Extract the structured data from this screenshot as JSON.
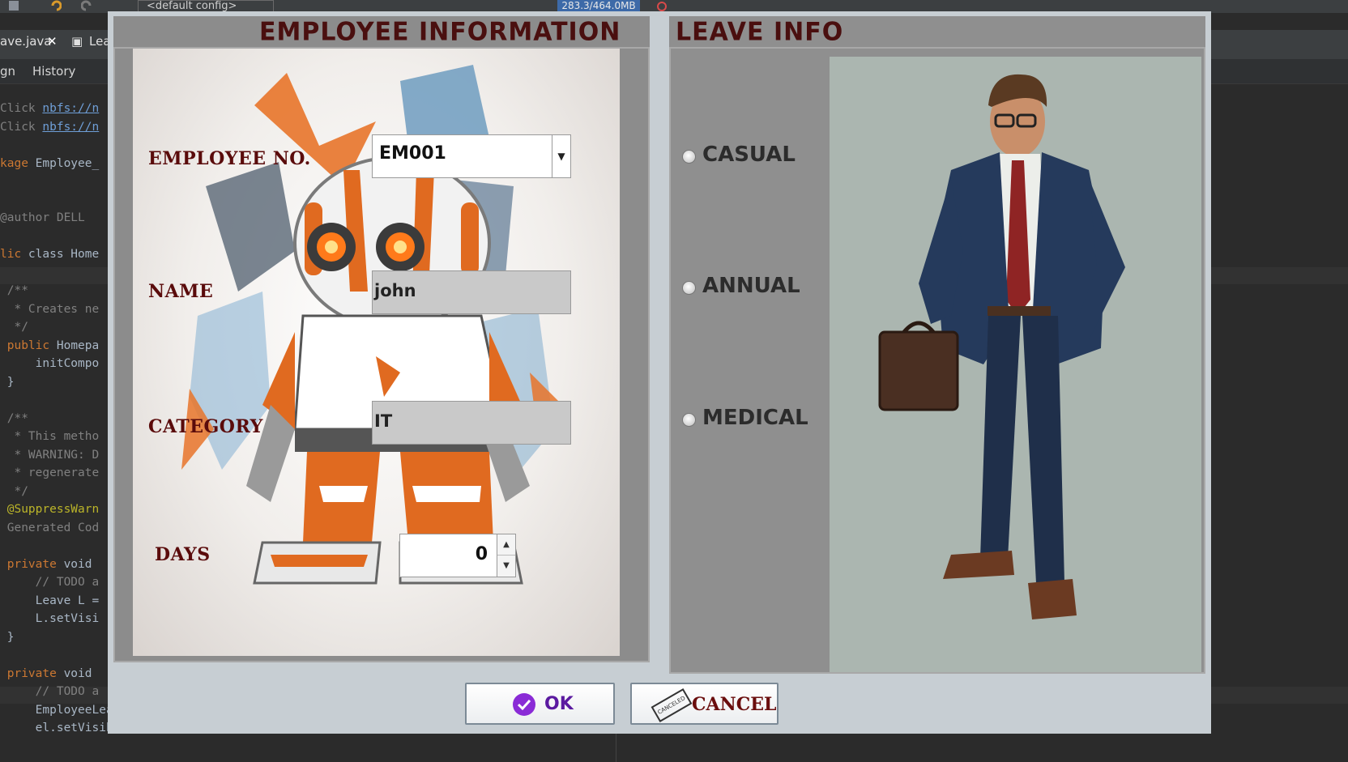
{
  "ide": {
    "config": "<default config>",
    "memory": "283.3/464.0MB",
    "tabs": [
      "ave.java",
      "Lea"
    ],
    "subtabs": [
      "gn",
      "History"
    ],
    "code_lines": [
      {
        "t": "Click nbfs://n",
        "c": "cm"
      },
      {
        "t": "Click nbfs://n",
        "c": "cm"
      },
      {
        "t": "",
        "c": ""
      },
      {
        "t": "kage Employee_",
        "c": "pl"
      },
      {
        "t": "",
        "c": ""
      },
      {
        "t": "",
        "c": ""
      },
      {
        "t": "@author DELL",
        "c": "cm"
      },
      {
        "t": "",
        "c": ""
      },
      {
        "t": "lic class Home",
        "c": "pl"
      },
      {
        "t": "",
        "c": ""
      },
      {
        "t": " /**",
        "c": "cm"
      },
      {
        "t": "  * Creates ne",
        "c": "cm"
      },
      {
        "t": "  */",
        "c": "cm"
      },
      {
        "t": " public Homepa",
        "c": "pl"
      },
      {
        "t": "     initCompo",
        "c": "pl"
      },
      {
        "t": " }",
        "c": "pl"
      },
      {
        "t": "",
        "c": ""
      },
      {
        "t": " /**",
        "c": "cm"
      },
      {
        "t": "  * This metho",
        "c": "cm"
      },
      {
        "t": "  * WARNING: D",
        "c": "cm"
      },
      {
        "t": "  * regenerate",
        "c": "cm"
      },
      {
        "t": "  */",
        "c": "cm"
      },
      {
        "t": " @SuppressWarn",
        "c": "ann"
      },
      {
        "t": " Generated Cod",
        "c": "cm"
      },
      {
        "t": "",
        "c": ""
      },
      {
        "t": " private void ",
        "c": "pl"
      },
      {
        "t": "     // TODO a",
        "c": "cm"
      },
      {
        "t": "     Leave L =",
        "c": "pl"
      },
      {
        "t": "     L.setVisi",
        "c": "pl"
      },
      {
        "t": " }",
        "c": "pl"
      },
      {
        "t": "",
        "c": ""
      },
      {
        "t": " private void ",
        "c": "pl"
      },
      {
        "t": "     // TODO a",
        "c": "cm"
      },
      {
        "t": "     EmployeeLeave el = new EmployeeLeave();",
        "c": "pl"
      },
      {
        "t": "     el.setVisible(true);",
        "c": "pl"
      }
    ]
  },
  "dialog": {
    "employee_panel": {
      "title": "EMPLOYEE INFORMATION",
      "employee_no": {
        "label": "EMPLOYEE NO.",
        "value": "EM001"
      },
      "name": {
        "label": "NAME",
        "value": "john"
      },
      "category": {
        "label": "CATEGORY",
        "value": "IT"
      },
      "days": {
        "label": "DAYS",
        "value": "0"
      }
    },
    "leave_panel": {
      "title": "LEAVE INFO",
      "options": [
        "CASUAL",
        "ANNUAL",
        "MEDICAL"
      ]
    },
    "buttons": {
      "ok": "OK",
      "cancel": "CANCEL",
      "cancel_stamp": "CANCELED"
    }
  },
  "colors": {
    "title": "#4a0f0f",
    "label": "#5a0b0b",
    "ok_icon": "#8a2bd6",
    "ok_text": "#5b1aa0",
    "cancel_text": "#6a0d0d"
  }
}
